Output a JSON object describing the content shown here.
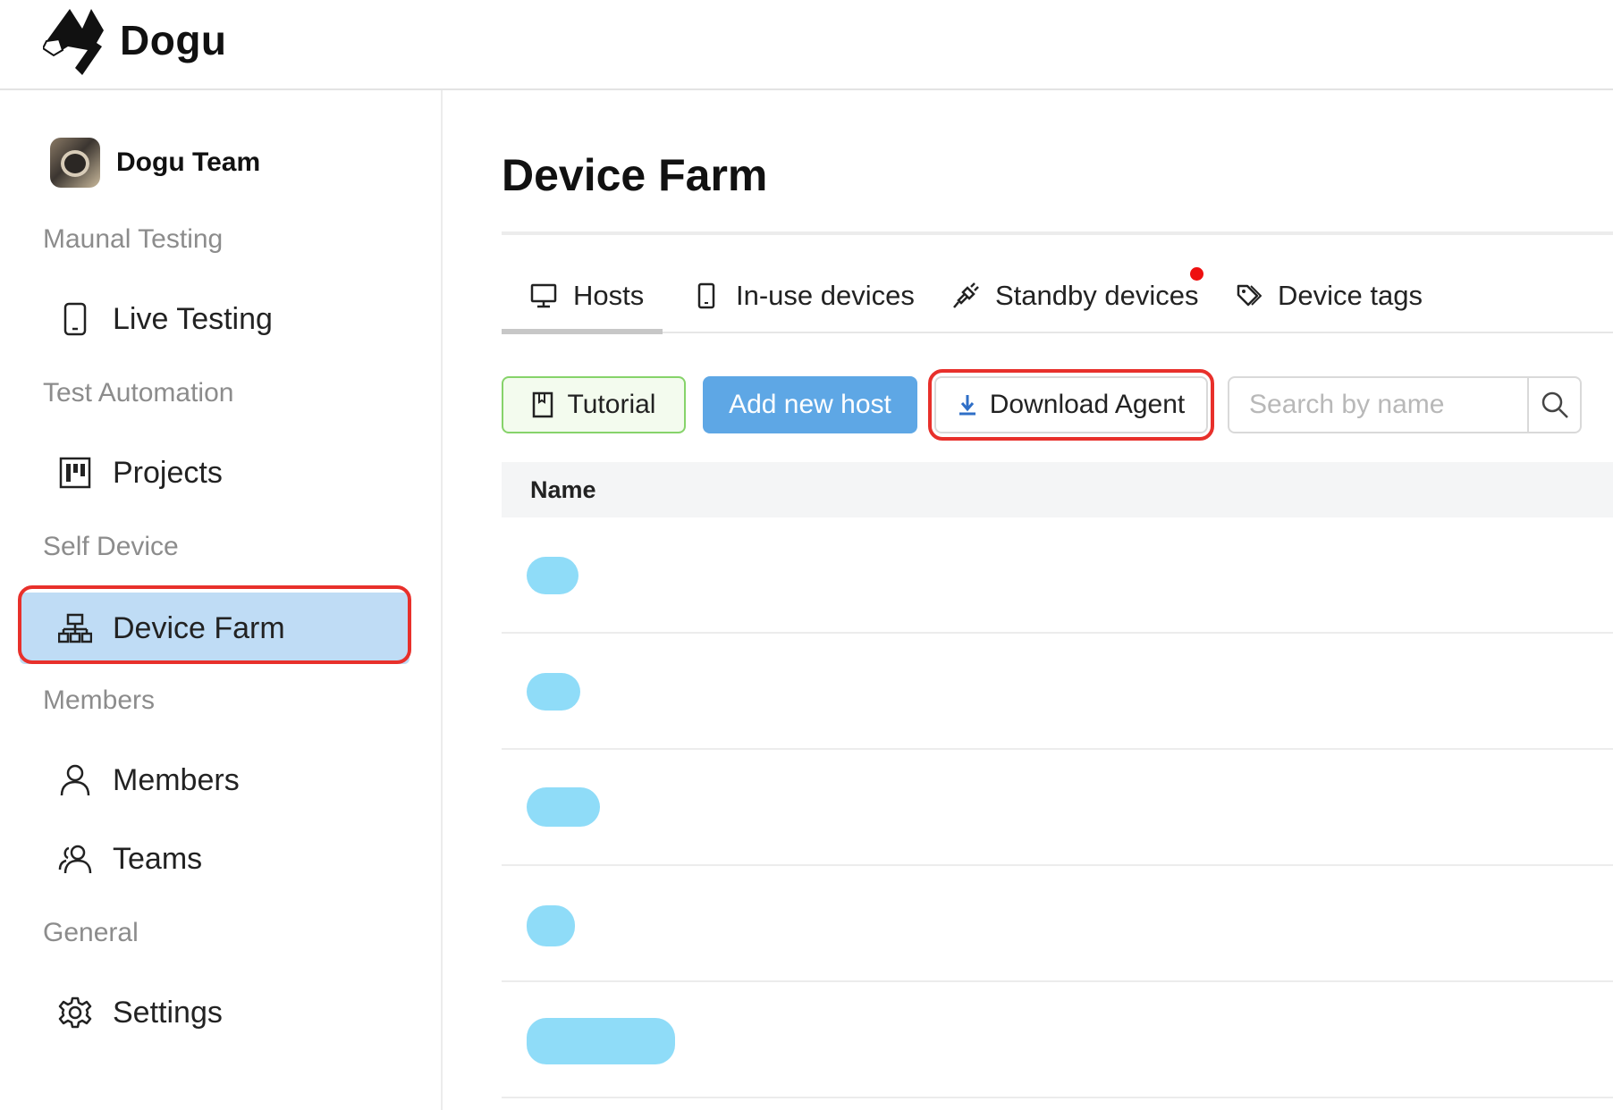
{
  "brand": {
    "name": "Dogu"
  },
  "sidebar": {
    "team_name": "Dogu Team",
    "sections": {
      "manual": "Maunal Testing",
      "automation": "Test Automation",
      "self_device": "Self Device",
      "members": "Members",
      "general": "General"
    },
    "items": {
      "live_testing": {
        "label": "Live Testing",
        "icon": "smartphone-icon"
      },
      "projects": {
        "label": "Projects",
        "icon": "project-board-icon"
      },
      "device_farm": {
        "label": "Device Farm",
        "icon": "cluster-icon",
        "active": true
      },
      "members": {
        "label": "Members",
        "icon": "user-icon"
      },
      "teams": {
        "label": "Teams",
        "icon": "team-icon"
      },
      "settings": {
        "label": "Settings",
        "icon": "gear-icon"
      }
    }
  },
  "main": {
    "title": "Device Farm",
    "tabs": [
      {
        "label": "Hosts",
        "icon": "desktop-icon",
        "active": true
      },
      {
        "label": "In-use devices",
        "icon": "mobile-icon"
      },
      {
        "label": "Standby devices",
        "icon": "plug-icon",
        "notification": true
      },
      {
        "label": "Device tags",
        "icon": "tags-icon"
      }
    ],
    "toolbar": {
      "tutorial_label": "Tutorial",
      "add_host_label": "Add new host",
      "download_agent_label": "Download Agent",
      "search_placeholder": "Search by name"
    },
    "table": {
      "columns": [
        "Name"
      ],
      "rows": 5,
      "note_redacted": true
    }
  },
  "colors": {
    "accent_blue": "#5ea7e5",
    "active_nav_bg": "#bfdcf5",
    "highlight_red": "#e8302b",
    "tutorial_green": "#86d36a",
    "redacted_pill": "#8fdcf8"
  }
}
